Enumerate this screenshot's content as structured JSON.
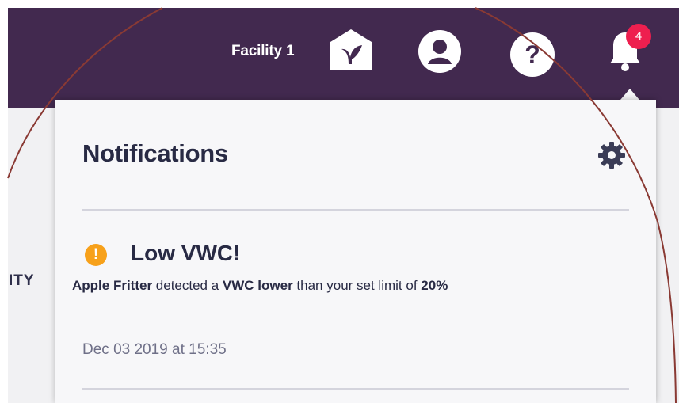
{
  "header": {
    "facility_name": "Facility 1",
    "notification_count": "4"
  },
  "background": {
    "partial_column_label": "ITY"
  },
  "notifications": {
    "title": "Notifications",
    "items": [
      {
        "title": "Low VWC!",
        "alert_glyph": "!",
        "message": {
          "plant": "Apple Fritter",
          "part1": " detected a ",
          "metric": "VWC lower",
          "part2": " than your set limit of ",
          "limit": "20%"
        },
        "timestamp": "Dec 03 2019 at 15:35"
      }
    ]
  },
  "colors": {
    "header_bg": "#42294f",
    "badge_bg": "#ee1f4f",
    "alert_warning": "#f7a11b",
    "annotation_circle": "#8a3a34"
  },
  "icons": [
    "facility-icon",
    "user-icon",
    "help-icon",
    "bell-icon",
    "gear-icon",
    "alert-icon"
  ]
}
